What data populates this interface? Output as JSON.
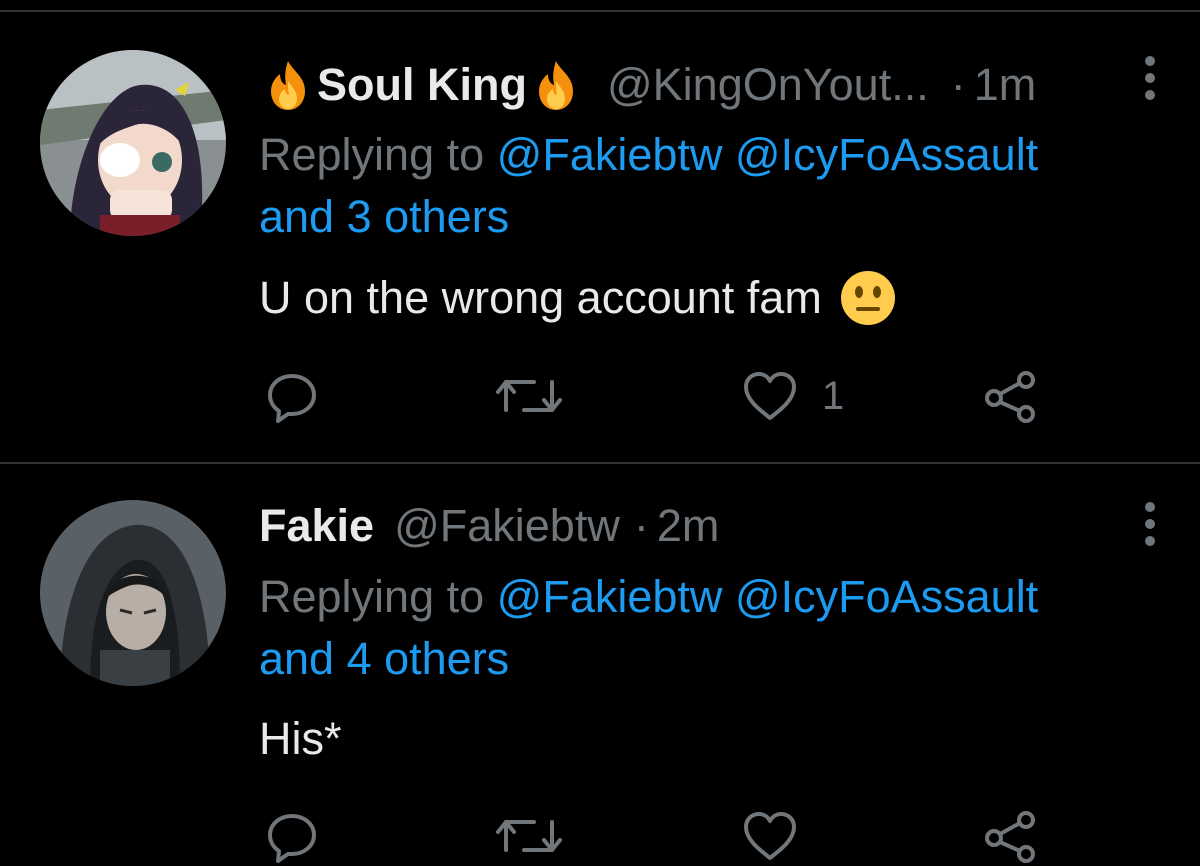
{
  "tweets": [
    {
      "name": "Soul King",
      "handle": "@KingOnYout...",
      "separator": "·",
      "time": "1m",
      "replying_to_label": "Replying to",
      "mention_1": "@Fakiebtw",
      "mention_2": "@IcyFoAssault",
      "and_others": "and 3 others",
      "text": "U on the wrong account fam",
      "text_emoji": "neutral-face-emoji",
      "like_count": "1",
      "name_decoration": "fire-emoji"
    },
    {
      "name": "Fakie",
      "handle": "@Fakiebtw",
      "separator": "·",
      "time": "2m",
      "replying_to_label": "Replying to",
      "mention_1": "@Fakiebtw",
      "mention_2": "@IcyFoAssault",
      "and_others": "and 4 others",
      "text": "His*",
      "like_count": ""
    }
  ],
  "action_icons": [
    "reply-icon",
    "retweet-icon",
    "like-icon",
    "share-icon"
  ],
  "colors": {
    "background": "#000000",
    "primary_text": "#e7e9ea",
    "secondary_text": "#71767b",
    "accent": "#1d9bf0",
    "divider": "#2f3336"
  }
}
